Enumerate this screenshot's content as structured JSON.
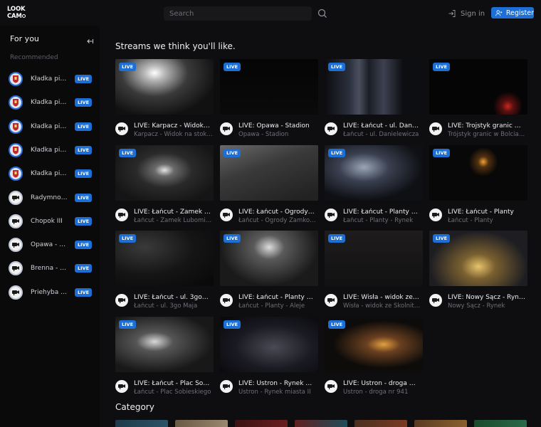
{
  "header": {
    "logo_line1": "LOOK",
    "logo_line2": "CAM",
    "search_placeholder": "Search",
    "signin_label": "Sign in",
    "register_label": "Register",
    "accent": "#1d6fd6"
  },
  "sidebar": {
    "title": "For you",
    "subtitle": "Recommended",
    "items": [
      {
        "name": "Kładka pie…",
        "live": "LIVE",
        "icon": "emblem-icon"
      },
      {
        "name": "Kładka pie…",
        "live": "LIVE",
        "icon": "emblem-icon"
      },
      {
        "name": "Kładka pie…",
        "live": "LIVE",
        "icon": "emblem-icon"
      },
      {
        "name": "Kładka pie…",
        "live": "LIVE",
        "icon": "emblem-icon"
      },
      {
        "name": "Kładka pie…",
        "live": "LIVE",
        "icon": "emblem-icon"
      },
      {
        "name": "Radymno …",
        "live": "LIVE",
        "icon": "camera-icon"
      },
      {
        "name": "Chopok III",
        "live": "LIVE",
        "icon": "camera-icon"
      },
      {
        "name": "Opawa - S…",
        "live": "LIVE",
        "icon": "camera-icon"
      },
      {
        "name": "Brenna - B…",
        "live": "LIVE",
        "icon": "camera-icon"
      },
      {
        "name": "Priehyba - …",
        "live": "LIVE",
        "icon": "camera-icon"
      }
    ]
  },
  "main": {
    "streams_title": "Streams we think you'll like.",
    "category_title": "Category",
    "streams": [
      {
        "live": "LIVE",
        "title": "LIVE: Karpacz - Widok…",
        "sub": "Karpacz - Widok na stok…"
      },
      {
        "live": "LIVE",
        "title": "LIVE: Opawa - Stadion",
        "sub": "Opawa - Stadion"
      },
      {
        "live": "LIVE",
        "title": "LIVE: Łańcut - ul. Dan…",
        "sub": "Łańcut - ul. Danielewicza"
      },
      {
        "live": "LIVE",
        "title": "LIVE: Trojstyk granic …",
        "sub": "Trójstyk granic w Bolciac…"
      },
      {
        "live": "LIVE",
        "title": "LIVE: Łańcut - Zamek …",
        "sub": "Łańcut - Zamek Lubomir…"
      },
      {
        "live": "LIVE",
        "title": "LIVE: Łańcut - Ogrody…",
        "sub": "Łańcut - Ogrody Zamkowe"
      },
      {
        "live": "LIVE",
        "title": "LIVE: Łańcut - Planty …",
        "sub": "Łańcut - Planty - Rynek"
      },
      {
        "live": "LIVE",
        "title": "LIVE: Łańcut - Planty",
        "sub": "Łańcut - Planty"
      },
      {
        "live": "LIVE",
        "title": "LIVE: Łańcut - ul. 3go…",
        "sub": "Łańcut - ul. 3go Maja"
      },
      {
        "live": "LIVE",
        "title": "LIVE: Łańcut - Planty …",
        "sub": "Łańcut - Planty - Aleje"
      },
      {
        "live": "LIVE",
        "title": "LIVE: Wisła - widok ze…",
        "sub": "Wisła - widok ze Skolnite…"
      },
      {
        "live": "LIVE",
        "title": "LIVE: Nowy Sącz - Ryn…",
        "sub": "Nowy Sącz - Rynek"
      },
      {
        "live": "LIVE",
        "title": "LIVE: Łańcut - Plac So…",
        "sub": "Łańcut - Plac Sobieskiego"
      },
      {
        "live": "LIVE",
        "title": "LIVE: Ustron - Rynek …",
        "sub": "Ustron - Rynek miasta II"
      },
      {
        "live": "LIVE",
        "title": "LIVE: Ustron - droga …",
        "sub": "Ustron - droga nr 941"
      }
    ]
  }
}
